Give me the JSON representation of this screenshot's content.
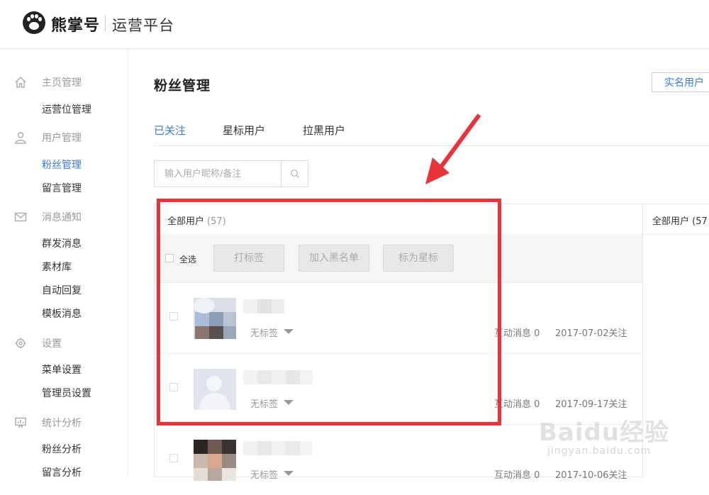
{
  "header": {
    "brand": "熊掌号",
    "platform": "运营平台"
  },
  "sidebar": {
    "groups": [
      {
        "title": "主页管理",
        "icon": "home-icon",
        "items": [
          "运营位管理"
        ]
      },
      {
        "title": "用户管理",
        "icon": "user-icon",
        "items": [
          "粉丝管理",
          "留言管理"
        ]
      },
      {
        "title": "消息通知",
        "icon": "mail-icon",
        "items": [
          "群发消息",
          "素材库",
          "自动回复",
          "模板消息"
        ]
      },
      {
        "title": "设置",
        "icon": "gear-icon",
        "items": [
          "菜单设置",
          "管理员设置"
        ]
      },
      {
        "title": "统计分析",
        "icon": "chart-icon",
        "items": [
          "粉丝分析",
          "留言分析"
        ]
      }
    ],
    "active_item": "粉丝管理"
  },
  "main": {
    "title": "粉丝管理",
    "realname_button": "实名用户",
    "tabs": [
      "已关注",
      "星标用户",
      "拉黑用户"
    ],
    "active_tab": "已关注",
    "search": {
      "placeholder": "输入用户昵称/备注",
      "value": ""
    },
    "panel": {
      "label": "全部用户",
      "count": "(57)",
      "select_all": "全选",
      "buttons": [
        "打标签",
        "加入黑名单",
        "标为星标"
      ]
    },
    "rows": [
      {
        "tag": "无标签",
        "messages": "互动消息 0",
        "date": "2017-07-02关注"
      },
      {
        "tag": "无标签",
        "messages": "互动消息 0",
        "date": "2017-09-17关注"
      },
      {
        "tag": "无标签",
        "messages": "互动消息 0",
        "date": "2017-10-06关注"
      }
    ],
    "right_panel_label": "全部用户 (57"
  },
  "watermark": {
    "main": "Baidu经验",
    "sub": "jingyan.baidu.com"
  },
  "colors": {
    "accent": "#3a7bd5",
    "highlight": "#e8333a"
  }
}
